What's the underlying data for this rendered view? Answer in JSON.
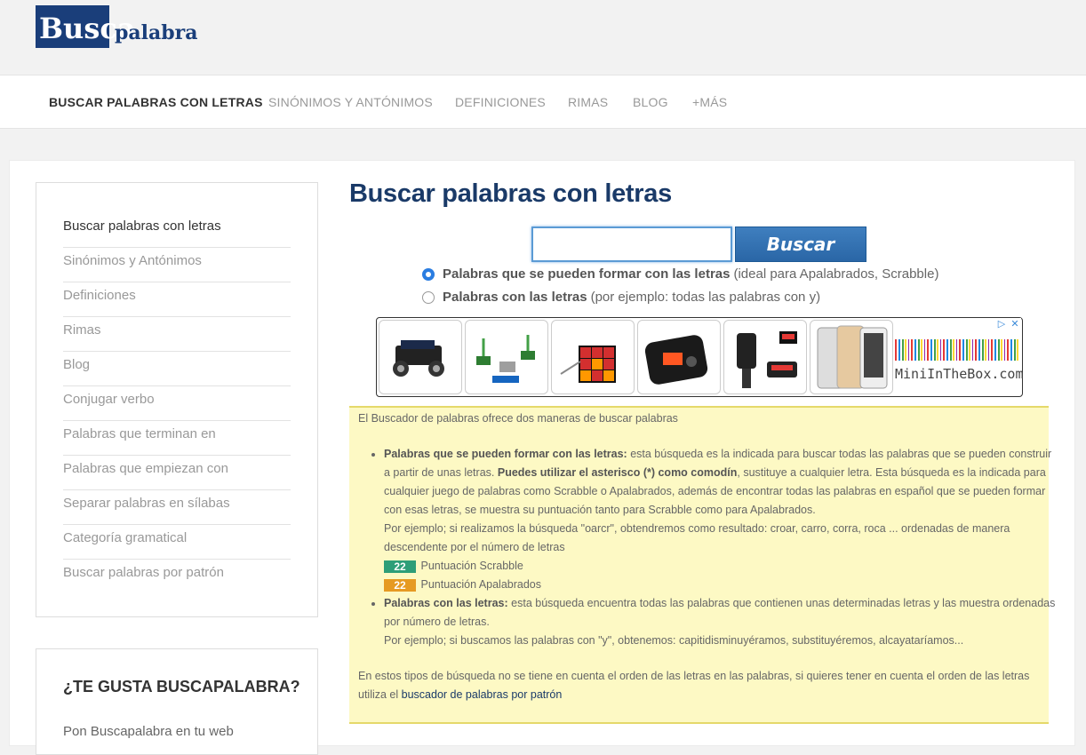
{
  "brand": {
    "logo_main": "Busca",
    "logo_rest": "palabra"
  },
  "nav": {
    "items": [
      {
        "label": "BUSCAR PALABRAS CON LETRAS",
        "active": true
      },
      {
        "label": "SINÓNIMOS Y ANTÓNIMOS"
      },
      {
        "label": "DEFINICIONES"
      },
      {
        "label": "RIMAS"
      },
      {
        "label": "BLOG"
      },
      {
        "label": "+MÁS"
      }
    ]
  },
  "sidebar": {
    "items": [
      {
        "label": "Buscar palabras con letras"
      },
      {
        "label": "Sinónimos y Antónimos"
      },
      {
        "label": "Definiciones"
      },
      {
        "label": "Rimas"
      },
      {
        "label": "Blog"
      },
      {
        "label": "Conjugar verbo"
      },
      {
        "label": "Palabras que terminan en"
      },
      {
        "label": "Palabras que empiezan con"
      },
      {
        "label": "Separar palabras en sílabas"
      },
      {
        "label": "Categoría gramatical"
      },
      {
        "label": "Buscar palabras por patrón"
      }
    ],
    "like_title": "¿TE GUSTA BUSCAPALABRA?",
    "like_sub": "Pon Buscapalabra en tu web"
  },
  "main": {
    "title": "Buscar palabras con letras",
    "search": {
      "value": "",
      "placeholder": "",
      "button": "Buscar"
    },
    "options": [
      {
        "bold": "Palabras que se pueden formar con las letras",
        "note": "(ideal para Apalabrados, Scrabble)",
        "checked": true
      },
      {
        "bold": "Palabras con las letras",
        "note": "(por ejemplo: todas las palabras con y)",
        "checked": false
      }
    ]
  },
  "ad": {
    "brand": "MiniInTheBox.com",
    "adchoices": "▷",
    "close": "✕"
  },
  "info": {
    "intro": "El Buscador de palabras ofrece dos maneras de buscar palabras",
    "item1_bold": "Palabras que se pueden formar con las letras:",
    "item1_text_a": "esta búsqueda es la indicada para buscar todas las palabras que se pueden construir a partir de unas letras.",
    "item1_bold2": "Puedes utilizar el asterisco (*) como comodín",
    "item1_text_b": ", sustituye a cualquier letra. Esta búsqueda es la indicada para cualquier juego de palabras como Scrabble o Apalabrados, además de encontrar todas las palabras en español que se pueden formar con esas letras, se muestra su puntuación tanto para Scrabble como para Apalabrados.",
    "item1_example": "Por ejemplo; si realizamos la búsqueda \"oarcr\", obtendremos como resultado: croar, carro, corra, roca ... ordenadas de manera descendente por el número de letras",
    "score_scrabble_value": "22",
    "score_scrabble_label": "Puntuación Scrabble",
    "score_apalabrados_value": "22",
    "score_apalabrados_label": "Puntuación Apalabrados",
    "item2_bold": "Palabras con las letras:",
    "item2_text": "esta búsqueda encuentra todas las palabras que contienen unas determinadas letras y las muestra ordenadas por número de letras.",
    "item2_example": "Por ejemplo; si buscamos las palabras con \"y\", obtenemos: capitidisminuyéramos, substituyéremos, alcayataríamos...",
    "outro": "En estos tipos de búsqueda no se tiene en cuenta el orden de las letras en las palabras, si quieres tener en cuenta el orden de las letras utiliza el",
    "outro_link": "buscador de palabras por patrón"
  }
}
